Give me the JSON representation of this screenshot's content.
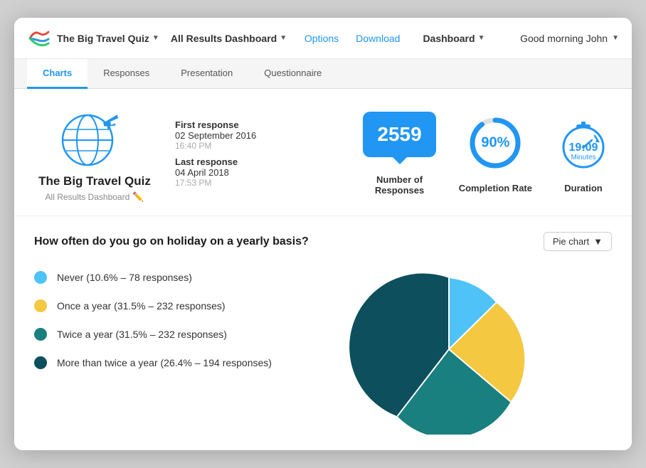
{
  "header": {
    "quiz_title": "The Big Travel Quiz",
    "dashboard_label": "All Results Dashboard",
    "nav_options": "Options",
    "nav_download": "Download",
    "nav_dashboard": "Dashboard",
    "greeting": "Good morning John"
  },
  "tabs": [
    {
      "label": "Charts",
      "active": true
    },
    {
      "label": "Responses",
      "active": false
    },
    {
      "label": "Presentation",
      "active": false
    },
    {
      "label": "Questionnaire",
      "active": false
    }
  ],
  "quiz_info": {
    "name": "The Big Travel Quiz",
    "sub_label": "All Results Dashboard",
    "first_response_label": "First response",
    "first_response_date": "02 September 2016",
    "first_response_time": "16:40 PM",
    "last_response_label": "Last response",
    "last_response_date": "04 April 2018",
    "last_response_time": "17:53 PM"
  },
  "stats": {
    "responses": {
      "value": "2559",
      "label": "Number of\nResponses"
    },
    "completion": {
      "value": "90%",
      "label": "Completion Rate",
      "percent": 90
    },
    "duration": {
      "time": "19:09",
      "unit": "Minutes",
      "label": "Duration"
    }
  },
  "chart": {
    "question": "How often do you go on holiday  on a yearly basis?",
    "chart_type_label": "Pie chart",
    "legend": [
      {
        "label": "Never (10.6% – 78 responses)",
        "color": "#4fc3f7"
      },
      {
        "label": "Once a year (31.5% – 232 responses)",
        "color": "#f5c842"
      },
      {
        "label": "Twice a year (31.5% – 232 responses)",
        "color": "#1a7f7f"
      },
      {
        "label": "More than twice a year (26.4% – 194 responses)",
        "color": "#0d4f5c"
      }
    ],
    "pie_segments": [
      {
        "label": "Never",
        "percent": 10.6,
        "color": "#4fc3f7"
      },
      {
        "label": "Once a year",
        "percent": 31.5,
        "color": "#f5c842"
      },
      {
        "label": "Twice a year",
        "percent": 31.5,
        "color": "#1a7f7f"
      },
      {
        "label": "More than twice",
        "percent": 26.4,
        "color": "#0d4f5c"
      }
    ]
  }
}
